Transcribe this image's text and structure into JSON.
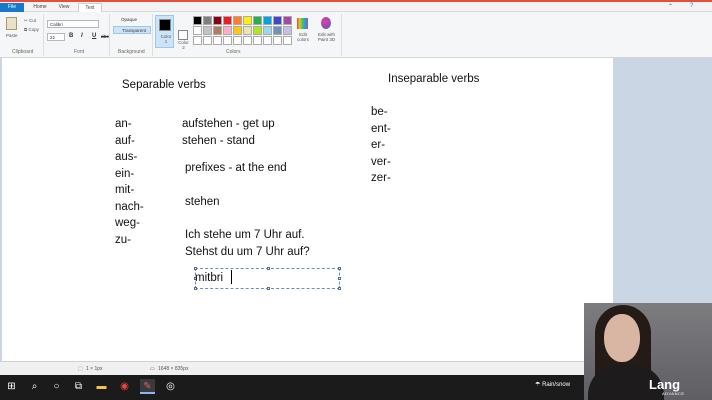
{
  "ribbon": {
    "tabs": [
      "File",
      "Home",
      "View",
      "Text"
    ],
    "clipboard": {
      "paste": "Paste",
      "cut": "Cut",
      "copy": "Copy",
      "label": "Clipboard"
    },
    "font": {
      "family": "Calibri",
      "size": "22",
      "bold": "B",
      "italic": "I",
      "underline": "U",
      "strike": "abc",
      "label": "Font"
    },
    "background": {
      "opaque": "Opaque",
      "transparent": "Transparent",
      "label": "Background"
    },
    "colors": {
      "color1": "Color 1",
      "color2": "Color 2",
      "edit": "Edit colors",
      "paint3d": "Edit with Paint 3D",
      "label": "Colors",
      "swatches": [
        "#000000",
        "#7f7f7f",
        "#880015",
        "#ed1c24",
        "#ff7f27",
        "#fff200",
        "#22b14c",
        "#00a2e8",
        "#3f48cc",
        "#a349a4",
        "#ffffff",
        "#c3c3c3",
        "#b97a57",
        "#ffaec9",
        "#ffc90e",
        "#efe4b0",
        "#b5e61d",
        "#99d9ea",
        "#7092be",
        "#c8bfe7",
        "#ffffff",
        "#ffffff",
        "#ffffff",
        "#ffffff",
        "#ffffff",
        "#ffffff",
        "#ffffff",
        "#ffffff",
        "#ffffff",
        "#ffffff"
      ]
    }
  },
  "canvas": {
    "heading_separable": "Separable verbs",
    "heading_inseparable": "Inseparable verbs",
    "separable_prefixes": [
      "an-",
      "auf-",
      "aus-",
      "ein-",
      "mit-",
      "nach-",
      "weg-",
      "zu-"
    ],
    "inseparable_prefixes": [
      "be-",
      "ent-",
      "er-",
      "ver-",
      "zer-"
    ],
    "example1": "aufstehen  - get up",
    "example2": "stehen - stand",
    "rule": "prefixes - at the end",
    "verb": "stehen",
    "sentence1": "Ich stehe um 7 Uhr auf.",
    "sentence2": "Stehst du um 7 Uhr auf?",
    "typing": "mitbri"
  },
  "status": {
    "selection": "1 × 1px",
    "canvas_size": "1648 × 835px"
  },
  "taskbar": {
    "weather": "Rain/snow"
  },
  "overlay": {
    "brand": "Lang",
    "brand_sub": "ADVANCE"
  }
}
